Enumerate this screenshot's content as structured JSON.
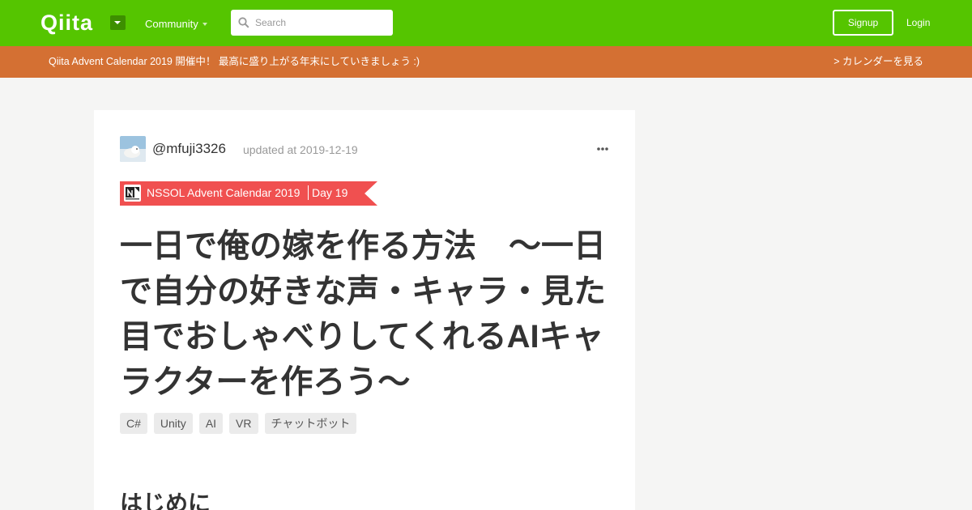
{
  "header": {
    "logo": "Qiita",
    "community_label": "Community",
    "search_placeholder": "Search",
    "signup_label": "Signup",
    "login_label": "Login",
    "brand_color": "#55c500"
  },
  "banner": {
    "text": "Qiita Advent Calendar 2019 開催中！ 最高に盛り上がる年末にしていきましょう :)",
    "link": "> カレンダーを見る",
    "color": "#d47033"
  },
  "article": {
    "author": "@mfuji3326",
    "updated": "updated at 2019-12-19",
    "calendar": {
      "name": "NSSOL Advent Calendar 2019",
      "day": "Day 19",
      "color": "#f05050"
    },
    "title": "一日で俺の嫁を作る方法　～一日で自分の好きな声・キャラ・見た目でおしゃべりしてくれるAIキャラクターを作ろう～",
    "tags": [
      "C#",
      "Unity",
      "AI",
      "VR",
      "チャットボット"
    ],
    "first_heading": "はじめに"
  }
}
